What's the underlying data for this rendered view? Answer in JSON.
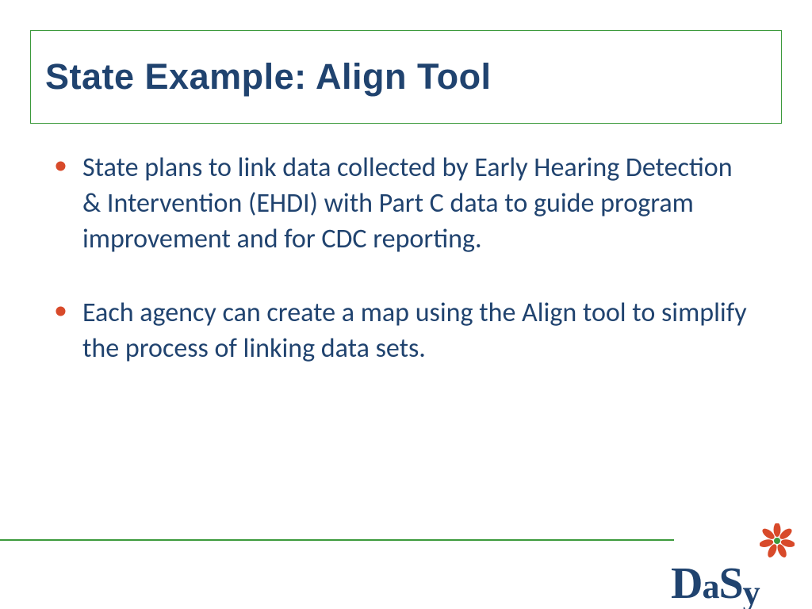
{
  "title": "State Example: Align Tool",
  "bullets": [
    "State plans to link data collected by Early Hearing Detection & Intervention (EHDI) with Part C data to guide program improvement and for CDC reporting.",
    "Each agency can create a map using the Align tool to simplify the process of linking data sets."
  ],
  "logo": {
    "text": "DaSy"
  }
}
